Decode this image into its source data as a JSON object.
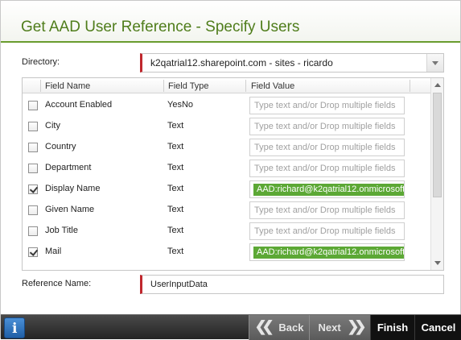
{
  "header": {
    "title": "Get AAD User Reference - Specify Users"
  },
  "directory": {
    "label": "Directory:",
    "value": "k2qatrial12.sharepoint.com - sites - ricardo"
  },
  "grid": {
    "columns": [
      "Field Name",
      "Field Type",
      "Field Value"
    ],
    "placeholder": "Type text and/or Drop multiple fields",
    "rows": [
      {
        "name": "Account Enabled",
        "type": "YesNo",
        "checked": false,
        "value": ""
      },
      {
        "name": "City",
        "type": "Text",
        "checked": false,
        "value": ""
      },
      {
        "name": "Country",
        "type": "Text",
        "checked": false,
        "value": ""
      },
      {
        "name": "Department",
        "type": "Text",
        "checked": false,
        "value": ""
      },
      {
        "name": "Display Name",
        "type": "Text",
        "checked": true,
        "value": "AAD:richard@k2qatrial12.onmicrosoft"
      },
      {
        "name": "Given Name",
        "type": "Text",
        "checked": false,
        "value": ""
      },
      {
        "name": "Job Title",
        "type": "Text",
        "checked": false,
        "value": ""
      },
      {
        "name": "Mail",
        "type": "Text",
        "checked": true,
        "value": "AAD:richard@k2qatrial12.onmicrosoft"
      }
    ]
  },
  "reference": {
    "label": "Reference Name:",
    "value": "UserInputData"
  },
  "footer": {
    "info_label": "i",
    "back_label": "Back",
    "next_label": "Next",
    "finish_label": "Finish",
    "cancel_label": "Cancel"
  },
  "colors": {
    "accent": "#4f7d1b",
    "token": "#5ca835",
    "required": "#c0272d"
  }
}
